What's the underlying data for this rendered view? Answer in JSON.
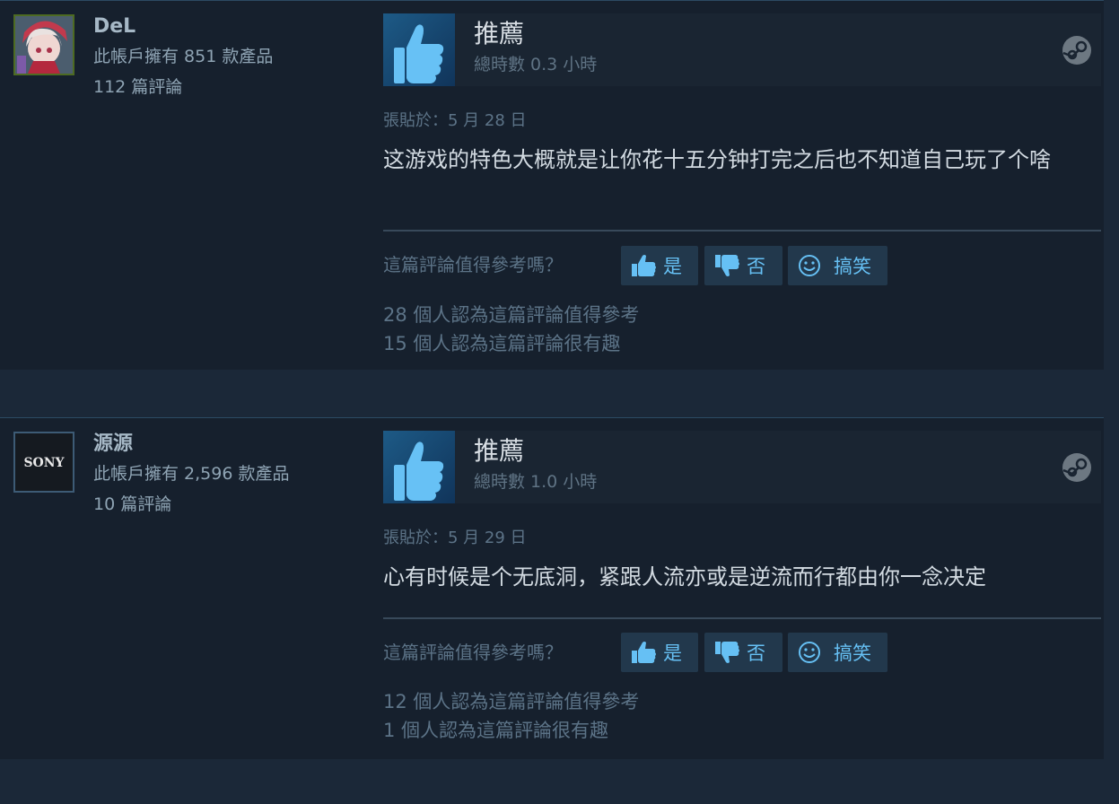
{
  "reviews": [
    {
      "author": {
        "name": "DeL",
        "products": "此帳戶擁有 851 款產品",
        "reviews": "112 篇評論",
        "avatar_icon": "anime-avatar"
      },
      "recommendation": {
        "title": "推薦",
        "hours": "總時數 0.3 小時"
      },
      "posted": "張貼於：5 月 28 日",
      "content": "这游戏的特色大概就是让你花十五分钟打完之后也不知道自己玩了个啥",
      "helpful_question": "這篇評論值得參考嗎？",
      "buttons": {
        "yes": "是",
        "no": "否",
        "funny": "搞笑"
      },
      "helpful_count": "28 個人認為這篇評論值得參考",
      "funny_count": "15 個人認為這篇評論很有趣"
    },
    {
      "author": {
        "name": "源源",
        "products": "此帳戶擁有 2,596 款產品",
        "reviews": "10 篇評論",
        "avatar_icon": "sony-logo-avatar",
        "avatar_text": "SONY"
      },
      "recommendation": {
        "title": "推薦",
        "hours": "總時數 1.0 小時"
      },
      "posted": "張貼於：5 月 29 日",
      "content": "心有时候是个无底洞，紧跟人流亦或是逆流而行都由你一念决定",
      "helpful_question": "這篇評論值得參考嗎？",
      "buttons": {
        "yes": "是",
        "no": "否",
        "funny": "搞笑"
      },
      "helpful_count": "12 個人認為這篇評論值得參考",
      "funny_count": "1 個人認為這篇評論很有趣"
    }
  ],
  "colors": {
    "background": "#1b2838",
    "card": "#16202d",
    "accent": "#66c0f4",
    "button": "#22384c",
    "muted": "#5c7387"
  }
}
